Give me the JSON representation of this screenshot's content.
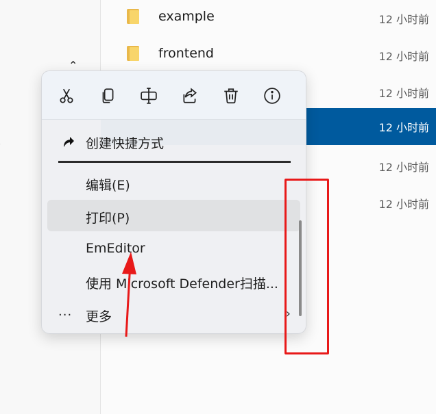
{
  "file_list": [
    {
      "name": "example",
      "time": "12 小时前",
      "selected": false
    },
    {
      "name": "frontend",
      "time": "12 小时前",
      "selected": false
    },
    {
      "name": "",
      "time": "12 小时前",
      "selected": false
    },
    {
      "name": "",
      "time": "12 小时前",
      "selected": true
    },
    {
      "name": "",
      "time": "12 小时前",
      "selected": false
    },
    {
      "name": "",
      "time": "12 小时前",
      "selected": false
    }
  ],
  "context_menu": {
    "toolbar_icons": [
      "cut-icon",
      "copy-icon",
      "rename-icon",
      "share-icon",
      "delete-icon",
      "properties-icon"
    ],
    "items": [
      {
        "label": "创建快捷方式",
        "icon": "shortcut-arrow-icon"
      },
      {
        "label": "编辑(E)"
      },
      {
        "label": "打印(P)",
        "hovered": true
      },
      {
        "label": "EmEditor"
      },
      {
        "label": "使用 Microsoft Defender扫描..."
      },
      {
        "label": "更多",
        "icon": "more-dots-icon"
      }
    ]
  },
  "colors": {
    "selection": "#005a9e",
    "annotation": "#e81919",
    "folder": "#f8d56a"
  }
}
